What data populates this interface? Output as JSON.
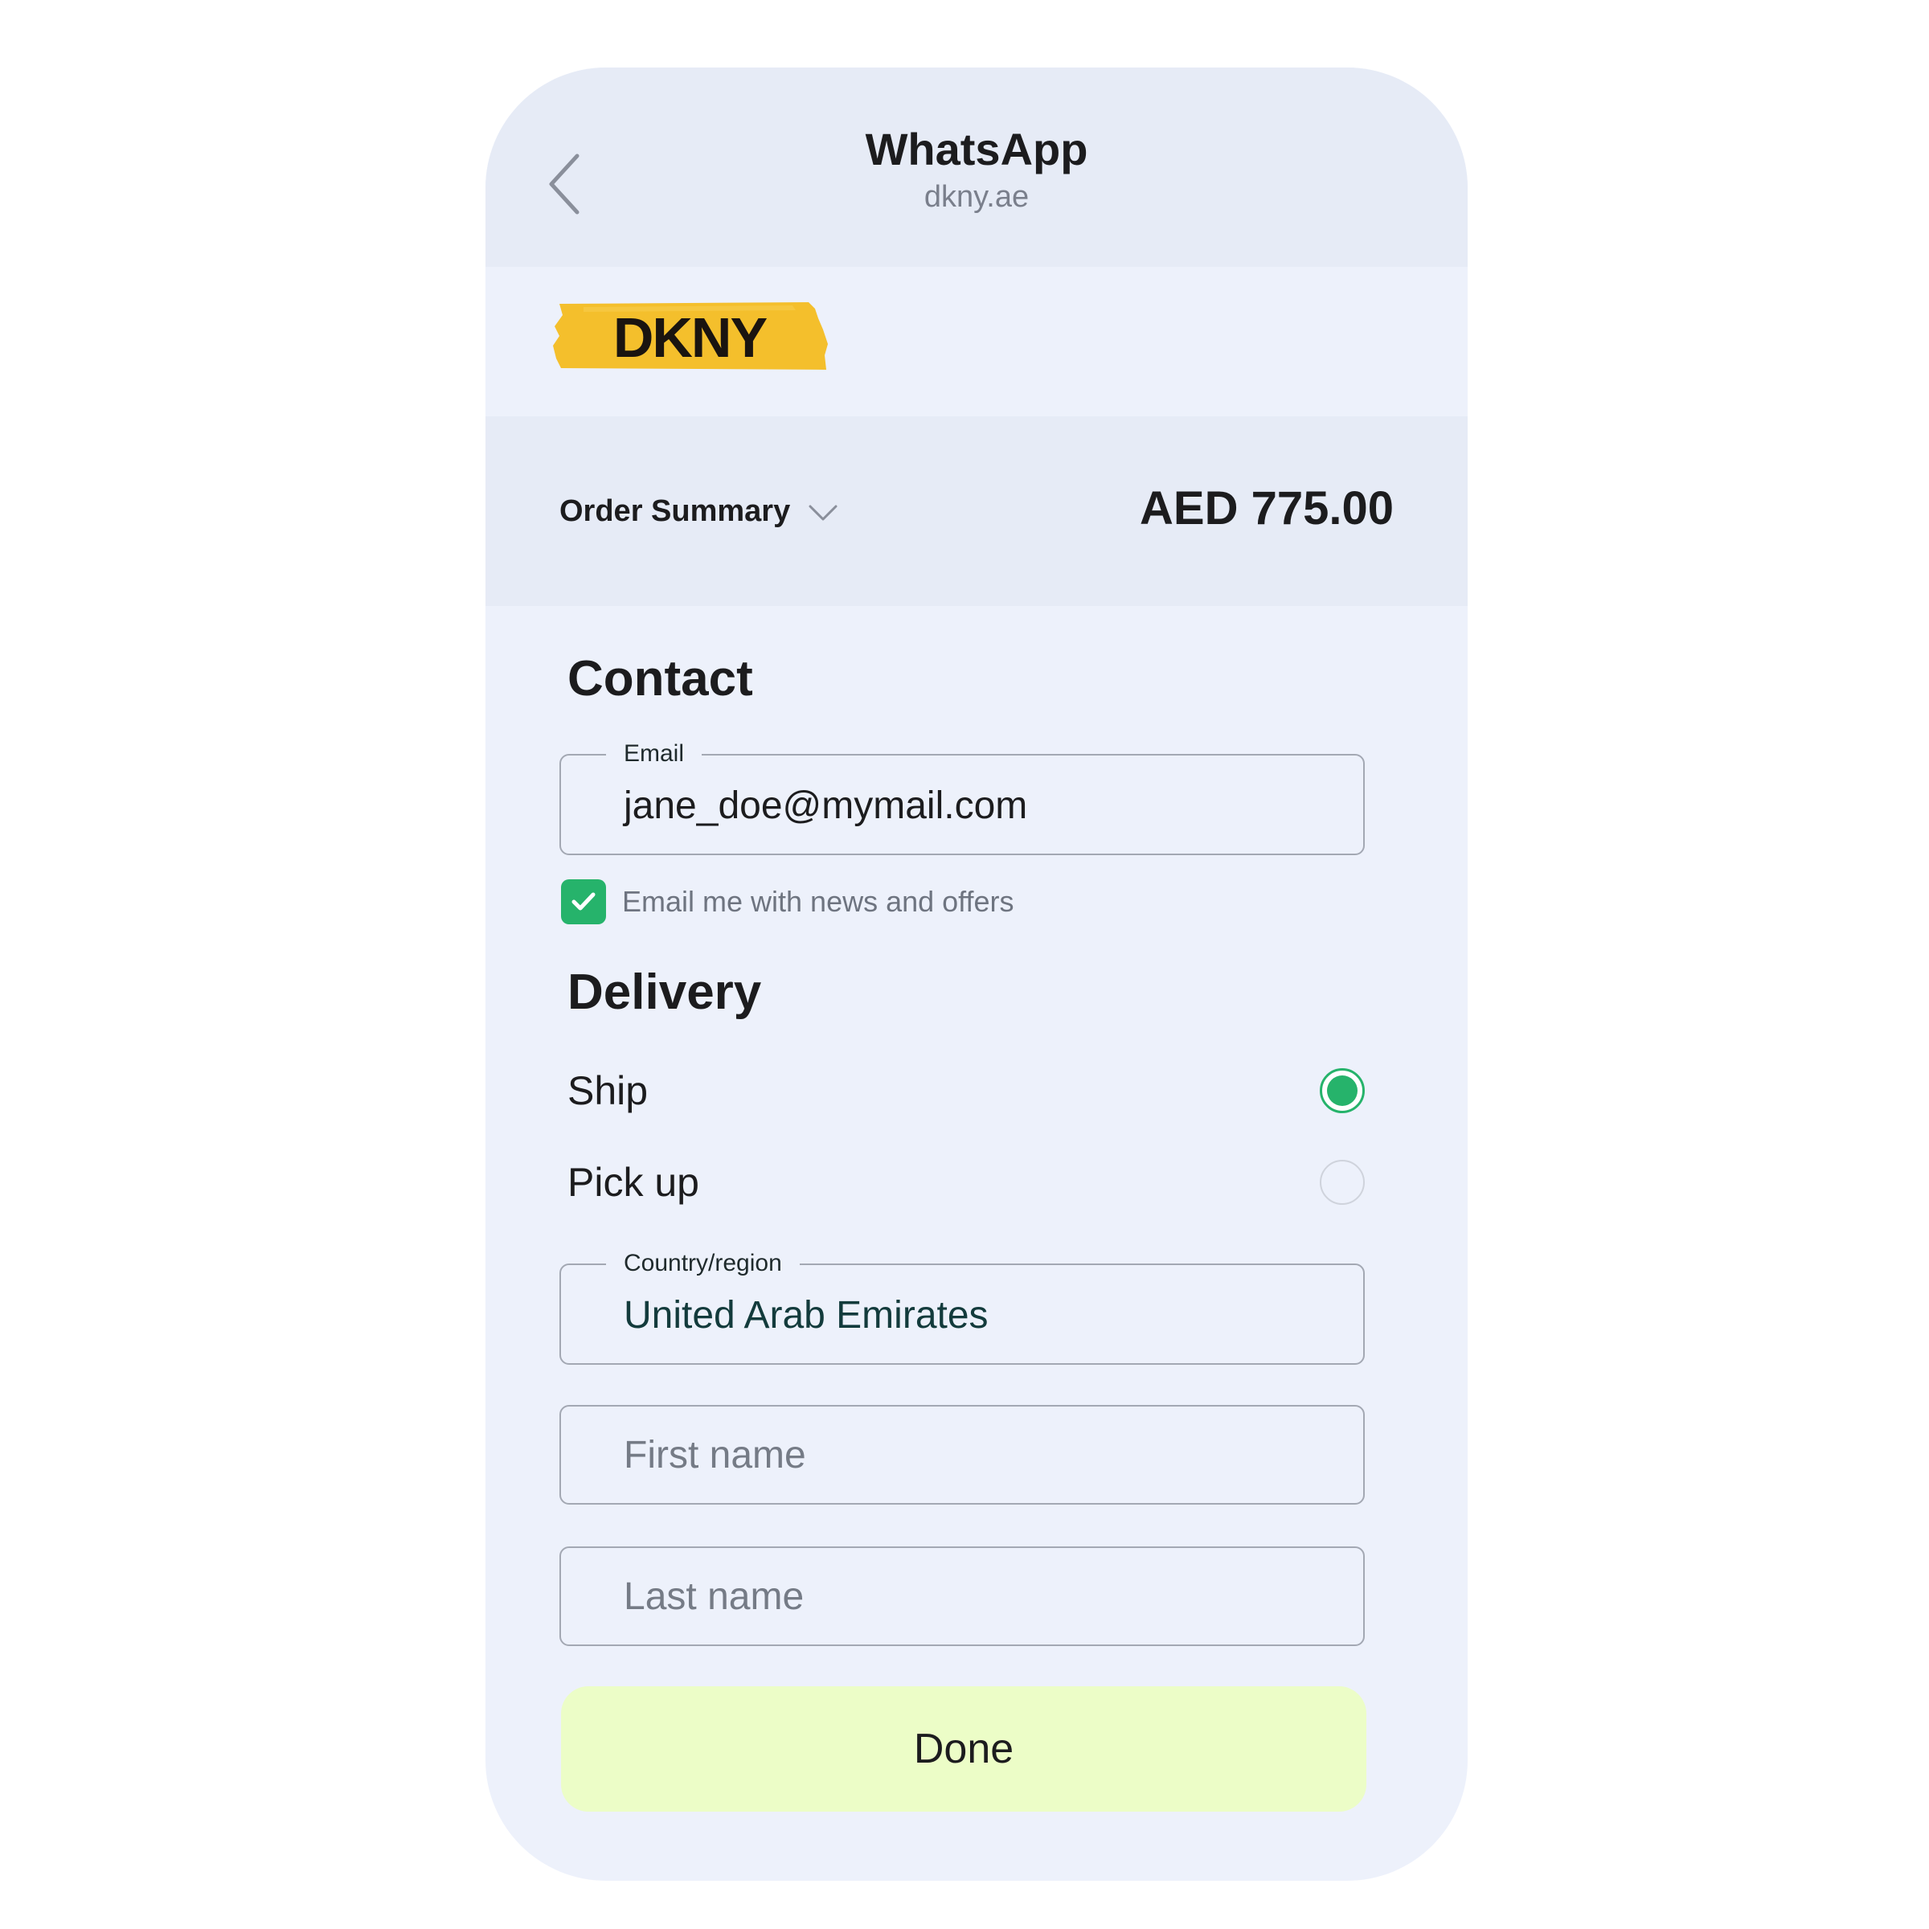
{
  "header": {
    "title": "WhatsApp",
    "subtitle": "dkny.ae",
    "back_icon": "chevron-left-icon"
  },
  "brand": {
    "logo_text": "DKNY",
    "logo_color": "#f4bf2c"
  },
  "order_summary": {
    "label": "Order Summary",
    "toggle_icon": "chevron-down-icon",
    "total": "AED 775.00"
  },
  "contact": {
    "heading": "Contact",
    "email_label": "Email",
    "email_value": "jane_doe@mymail.com",
    "newsletter_label": "Email me with news and offers",
    "newsletter_checked": true
  },
  "delivery": {
    "heading": "Delivery",
    "options": [
      {
        "label": "Ship",
        "selected": true
      },
      {
        "label": "Pick up",
        "selected": false
      }
    ],
    "country_label": "Country/region",
    "country_value": "United Arab Emirates",
    "first_name_placeholder": "First name",
    "last_name_placeholder": "Last name"
  },
  "actions": {
    "done_label": "Done"
  },
  "colors": {
    "accent_green": "#26b36b",
    "done_button_bg": "#ecfdc7",
    "screen_bg": "#edf1fb",
    "header_bg": "#e6ebf6"
  }
}
